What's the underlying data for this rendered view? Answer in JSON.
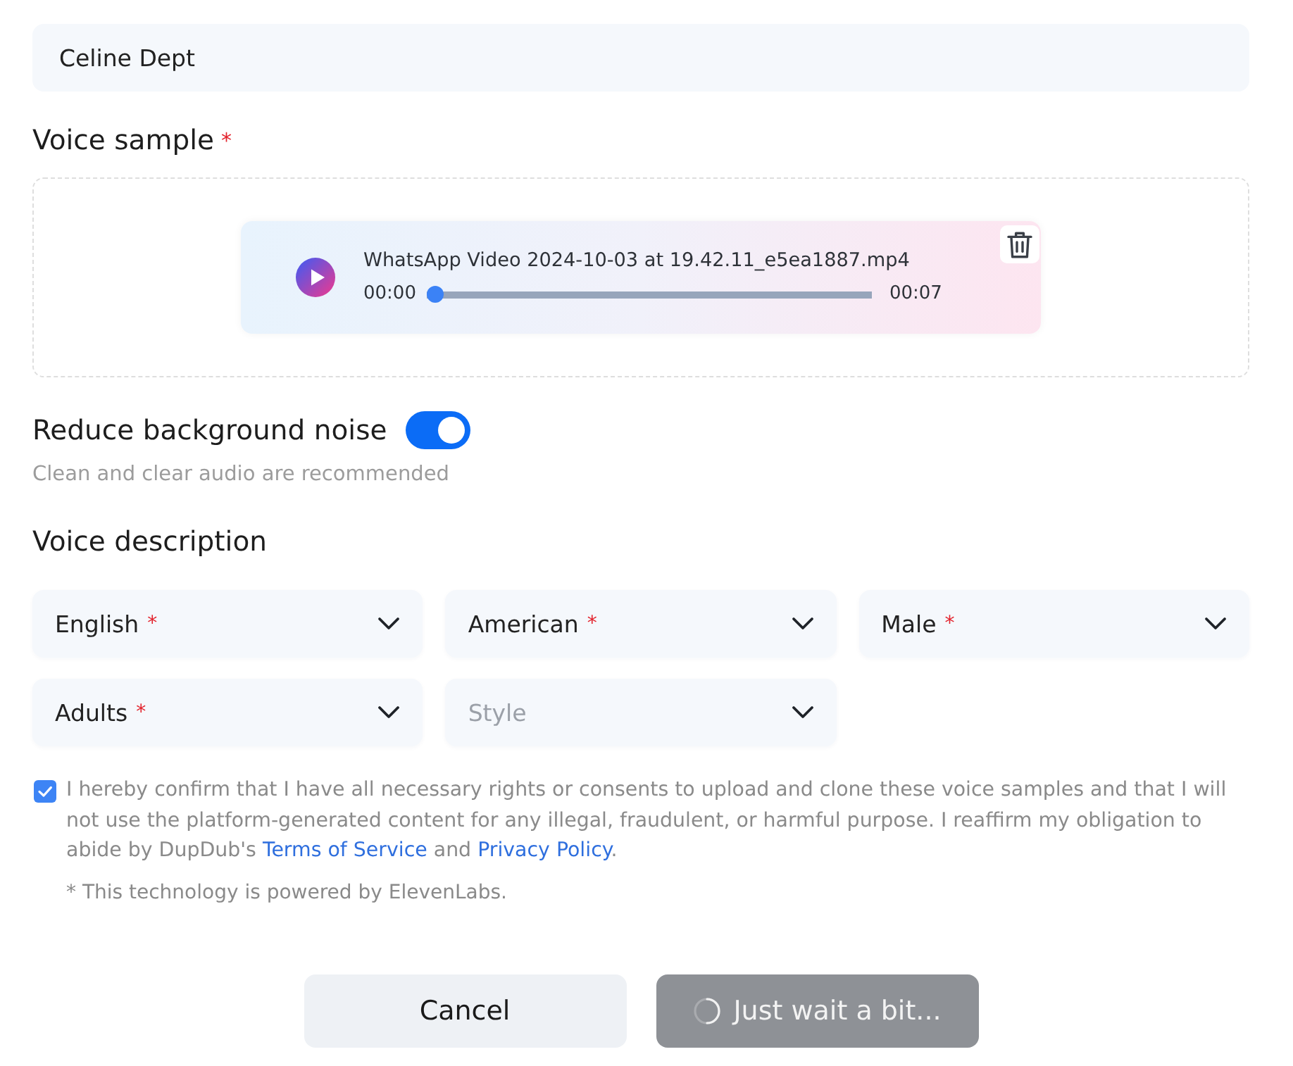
{
  "name_field": {
    "value": "Celine Dept"
  },
  "voice_sample": {
    "label": "Voice sample",
    "required_mark": "*",
    "file": {
      "name": "WhatsApp Video 2024-10-03 at 19.42.11_e5ea1887.mp4",
      "current_time": "00:00",
      "duration": "00:07",
      "level": 0
    }
  },
  "noise_reduction": {
    "label": "Reduce background noise",
    "on": true,
    "hint": "Clean and clear audio are recommended"
  },
  "voice_description": {
    "label": "Voice description",
    "selects": [
      {
        "value": "English",
        "required_mark": "*"
      },
      {
        "value": "American",
        "required_mark": "*"
      },
      {
        "value": "Male",
        "required_mark": "*"
      },
      {
        "value": "Adults",
        "required_mark": "*"
      },
      {
        "placeholder": "Style"
      }
    ]
  },
  "consent": {
    "checked": true,
    "parts": [
      {
        "kind": "text",
        "text": "I hereby confirm that I have all necessary rights or consents to upload and clone these voice samples and that I will not use the platform-generated content for any illegal, fraudulent, or harmful purpose. I reaffirm my obligation to abide by DupDub's "
      },
      {
        "kind": "link",
        "text": "Terms of Service"
      },
      {
        "kind": "text",
        "text": " and "
      },
      {
        "kind": "link",
        "text": "Privacy Policy"
      },
      {
        "kind": "text",
        "text": "."
      }
    ],
    "note": "* This technology is powered by ElevenLabs."
  },
  "buttons": [
    {
      "kind": "cancel",
      "label": "Cancel"
    },
    {
      "kind": "submit",
      "label": "Just wait a bit...",
      "loading": true
    }
  ]
}
